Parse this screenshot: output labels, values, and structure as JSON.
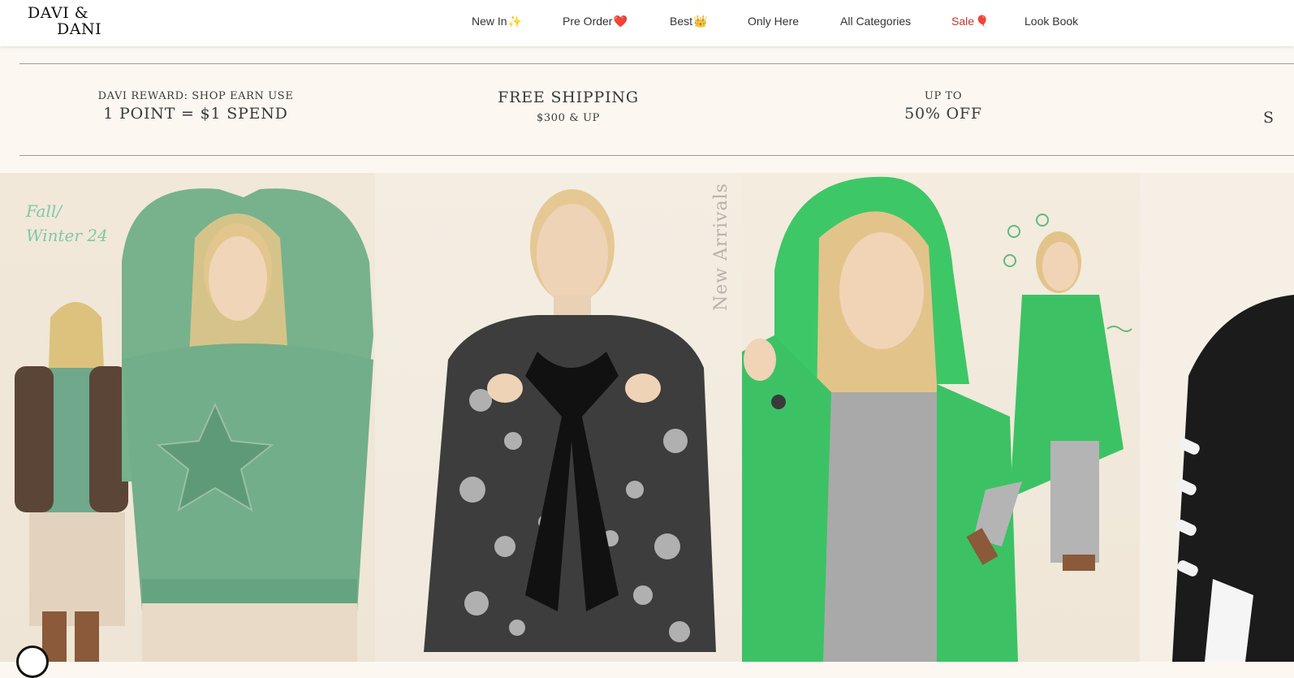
{
  "brand": {
    "logo_line1": "DAVI &",
    "logo_line2": "DANI"
  },
  "nav": {
    "items": [
      {
        "label": "New In",
        "emoji": "✨"
      },
      {
        "label": "Pre Order",
        "emoji": "❤️"
      },
      {
        "label": "Best",
        "emoji": "👑"
      },
      {
        "label": "Only Here",
        "emoji": ""
      },
      {
        "label": "All Categories",
        "emoji": ""
      },
      {
        "label": "Sale",
        "emoji": "🎈"
      },
      {
        "label": "Look Book",
        "emoji": ""
      }
    ]
  },
  "promos": [
    {
      "line1": "DAVI REWARD: SHOP EARN USE",
      "line2": "1 POINT = $1 SPEND"
    },
    {
      "line1": "FREE SHIPPING",
      "line2": "$300 & UP"
    },
    {
      "line1": "UP TO",
      "line2": "50% OFF"
    },
    {
      "line1": "S",
      "line2": ""
    }
  ],
  "hero": {
    "left_script_line1": "Fall/",
    "left_script_line2": "Winter 24",
    "middle_vertical": "New Arrivals"
  },
  "colors": {
    "header_bg": "#ffffff",
    "page_bg": "#fcf8f1",
    "sale_red": "#c0392b",
    "sage_green": "#6fb68a",
    "kelly_green": "#3ec766"
  }
}
